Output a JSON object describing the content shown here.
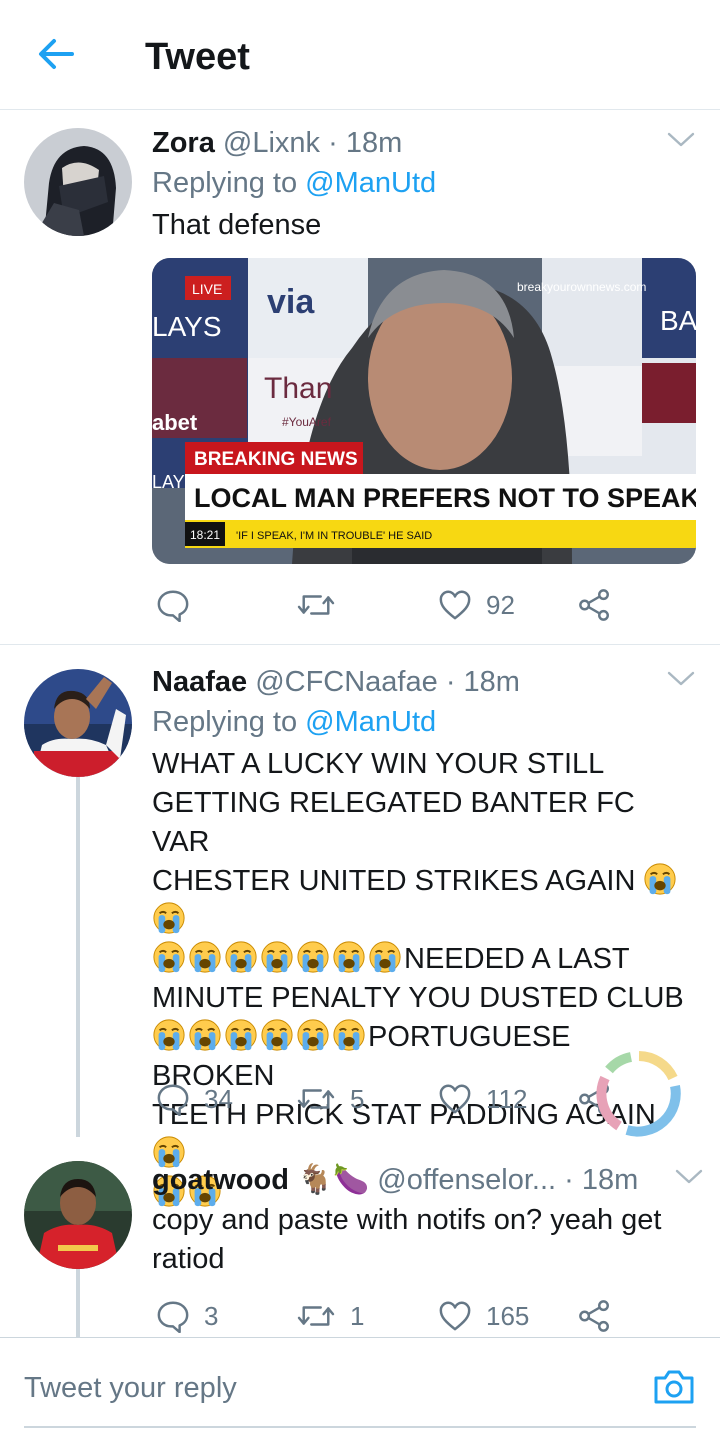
{
  "header": {
    "title": "Tweet"
  },
  "tweets": [
    {
      "name": "Zora",
      "handle": "@Lixnk",
      "time": "18m",
      "replying_prefix": "Replying to",
      "replying_handle": "@ManUtd",
      "text": "That defense",
      "media": {
        "live": "LIVE",
        "watermark": "breakyourownnews.com",
        "breaking": "BREAKING NEWS",
        "headline": "LOCAL MAN PREFERS NOT TO SPEAK",
        "clock": "18:21",
        "ticker": "'IF I SPEAK, I'M IN TROUBLE' HE SAID",
        "bg_texts": [
          "via",
          "LAYS",
          "Than",
          "#YouAref",
          "abet",
          "BA",
          "LAY"
        ]
      },
      "replies": "",
      "retweets": "",
      "likes": "92"
    },
    {
      "name": "Naafae",
      "handle": "@CFCNaafae",
      "time": "18m",
      "replying_prefix": "Replying to",
      "replying_handle": "@ManUtd",
      "text_lines": [
        "WHAT A LUCKY WIN YOUR STILL",
        "GETTING RELEGATED BANTER FC VAR",
        "CHESTER UNITED STRIKES AGAIN",
        "NEEDED A LAST",
        "MINUTE PENALTY YOU DUSTED CLUB",
        "PORTUGUESE BROKEN",
        "TEETH PRICK STAT PADDING AGAIN"
      ],
      "replies": "34",
      "retweets": "5",
      "likes": "112"
    },
    {
      "name": "goatwood",
      "name_emojis": "🐐🍆",
      "handle": "@offenselor...",
      "time": "18m",
      "text": "copy and paste with notifs on? yeah get ratiod",
      "replies": "3",
      "retweets": "1",
      "likes": "165"
    }
  ],
  "compose": {
    "placeholder": "Tweet your reply"
  },
  "colors": {
    "accent": "#1da1f2",
    "muted": "#657786",
    "text": "#14171a",
    "divider": "#e1e8ed"
  }
}
